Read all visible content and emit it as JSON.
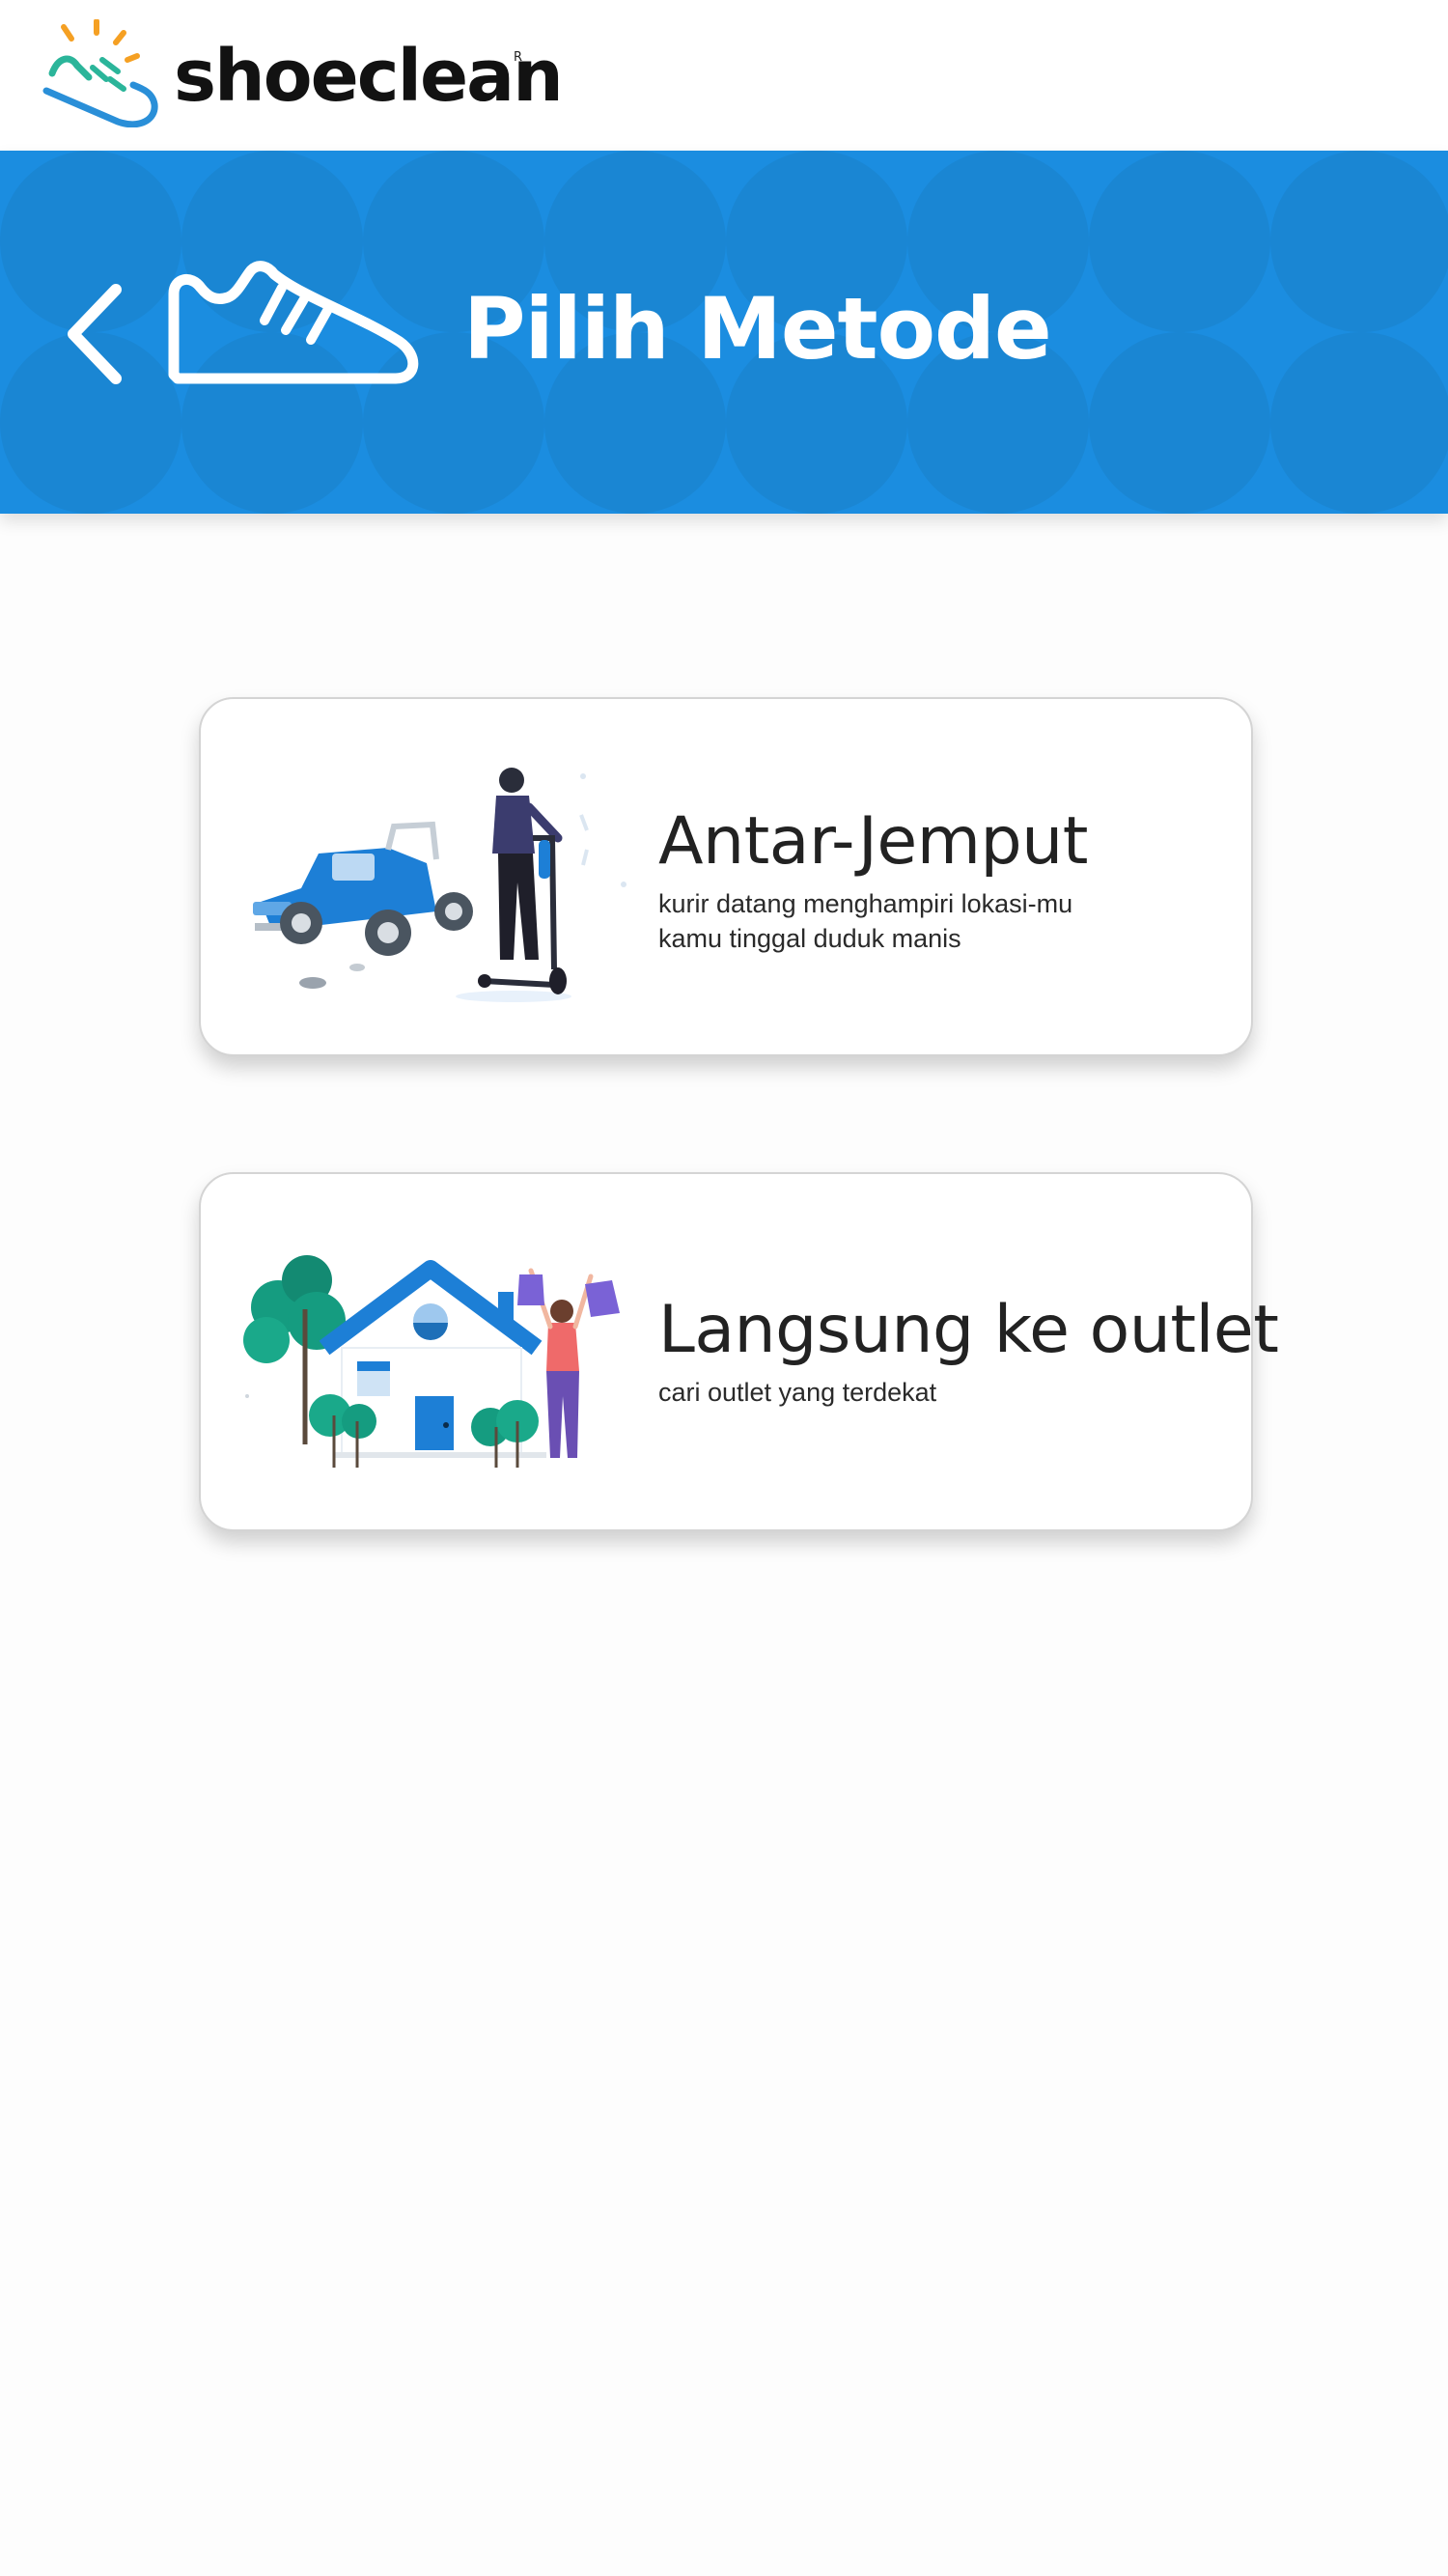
{
  "brand": {
    "name": "shoeclean",
    "reg_mark": "R",
    "logo_icon": "shoe-logo-icon",
    "colors": {
      "orange": "#f5a023",
      "green": "#2bb59a",
      "blue": "#2a8fd8"
    }
  },
  "header": {
    "title": "Pilih Metode",
    "back_icon": "chevron-left-icon",
    "title_icon": "sneaker-icon",
    "background": "#1b8de0"
  },
  "methods": [
    {
      "title": "Antar-Jemput",
      "description_lines": [
        "kurir datang menghampiri lokasi-mu",
        "kamu tinggal duduk manis"
      ],
      "illustration": "courier-jeep-scooter-illustration"
    },
    {
      "title": "Langsung ke outlet",
      "description_lines": [
        "cari outlet yang terdekat"
      ],
      "illustration": "house-shopping-woman-illustration"
    }
  ]
}
